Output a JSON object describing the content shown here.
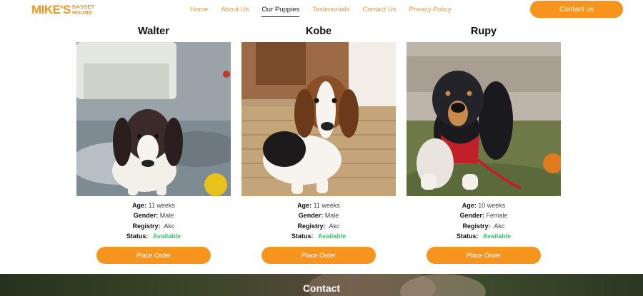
{
  "brand": {
    "main": "MIKE'S",
    "sub_top": "BASSET",
    "sub_bottom": "HOUND"
  },
  "nav": {
    "items": [
      {
        "label": "Home"
      },
      {
        "label": "About Us"
      },
      {
        "label": "Our Puppies"
      },
      {
        "label": "Testimonials"
      },
      {
        "label": "Contact Us"
      },
      {
        "label": "Privacy Policy"
      }
    ],
    "active": "Our Puppies"
  },
  "header": {
    "contact_button": "Contact us"
  },
  "labels": {
    "age": "Age:",
    "gender": "Gender:",
    "registry": "Registry:",
    "status": "Status:"
  },
  "puppies": [
    {
      "name": "Walter",
      "age": "11 weeks",
      "gender": "Male",
      "registry": ".Akc",
      "status": "Available",
      "button": "Place Order"
    },
    {
      "name": "Kobe",
      "age": "11 weeks",
      "gender": "Male",
      "registry": ".Akc",
      "status": "Available",
      "button": "Place Order"
    },
    {
      "name": "Rupy",
      "age": "10 weeks",
      "gender": "Female",
      "registry": ".Akc",
      "status": "Available",
      "button": "Place Order"
    }
  ],
  "colors": {
    "accent": "#f7941d",
    "available": "#2ecc71",
    "band": "#3a4529"
  },
  "contact_section": {
    "title": "Contact"
  }
}
